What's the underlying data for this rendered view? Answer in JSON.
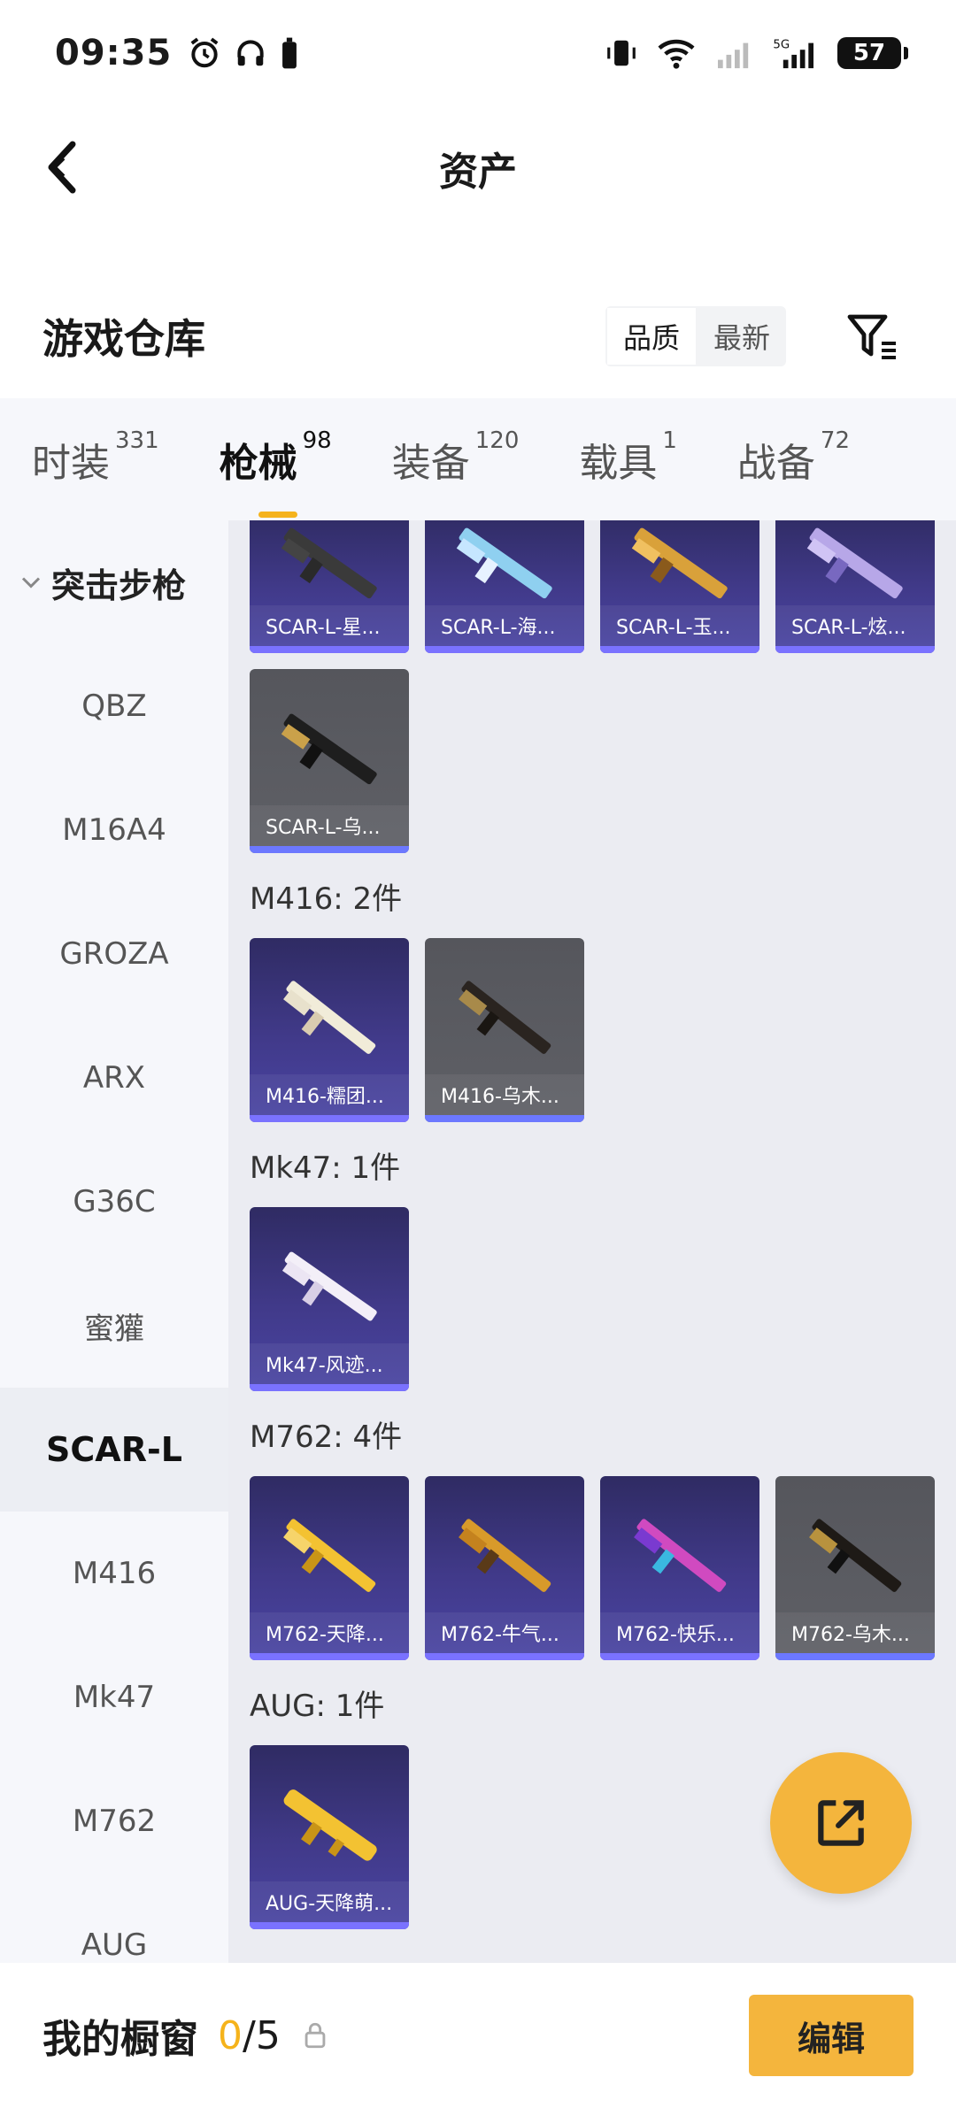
{
  "status": {
    "time": "09:35",
    "battery": "57"
  },
  "nav": {
    "title": "资产"
  },
  "section": {
    "title": "游戏仓库",
    "sort_quality": "品质",
    "sort_newest": "最新"
  },
  "tabs": [
    {
      "label": "时装",
      "count": "331"
    },
    {
      "label": "枪械",
      "count": "98"
    },
    {
      "label": "装备",
      "count": "120"
    },
    {
      "label": "载具",
      "count": "1"
    },
    {
      "label": "战备",
      "count": "72"
    }
  ],
  "sidebar": {
    "category": "突击步枪",
    "items": [
      "QBZ",
      "M16A4",
      "GROZA",
      "ARX",
      "G36C",
      "蜜獾",
      "SCAR-L",
      "M416",
      "Mk47",
      "M762",
      "AUG"
    ]
  },
  "groups": {
    "scar_top": [
      "SCAR-L-星...",
      "SCAR-L-海...",
      "SCAR-L-玉...",
      "SCAR-L-炫..."
    ],
    "scar_bottom": [
      "SCAR-L-乌..."
    ],
    "m416": {
      "label": "M416: 2件",
      "items": [
        "M416-糯团...",
        "M416-乌木..."
      ]
    },
    "mk47": {
      "label": "Mk47: 1件",
      "items": [
        "Mk47-风迹..."
      ]
    },
    "m762": {
      "label": "M762: 4件",
      "items": [
        "M762-天降...",
        "M762-牛气...",
        "M762-快乐...",
        "M762-乌木..."
      ]
    },
    "aug": {
      "label": "AUG: 1件",
      "items": [
        "AUG-天降萌..."
      ]
    }
  },
  "bottom": {
    "label": "我的橱窗",
    "current": "0",
    "total": "/5",
    "edit": "编辑"
  },
  "colors": {
    "accent": "#f4b53d",
    "card_purple": "#413a8a",
    "card_grey": "#5f6066"
  }
}
